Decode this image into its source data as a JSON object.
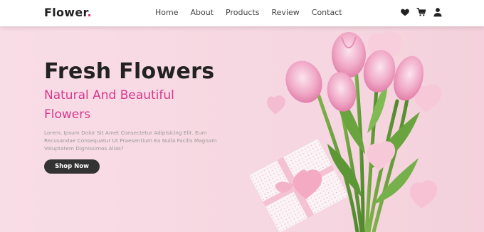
{
  "header": {
    "logo_text": "Flower",
    "logo_dot": ".",
    "nav": [
      "Home",
      "About",
      "Products",
      "Review",
      "Contact"
    ],
    "icons": [
      "heart-icon",
      "cart-icon",
      "user-icon"
    ]
  },
  "hero": {
    "title": "Fresh Flowers",
    "subtitle": "Natural And Beautiful Flowers",
    "description": "Lorem, Ipsum Dolor Sit Amet Consectetur Adipisicing Elit. Eum Recusandae Consequatur Ut Praesentium Ea Nulla Facilis Magnam Voluptatem Dignissimos Alias?",
    "button_label": "Shop Now"
  },
  "colors": {
    "accent": "#d6378f",
    "brand_dot": "#e91e63",
    "background": "#f6d9e3",
    "button": "#333333"
  }
}
